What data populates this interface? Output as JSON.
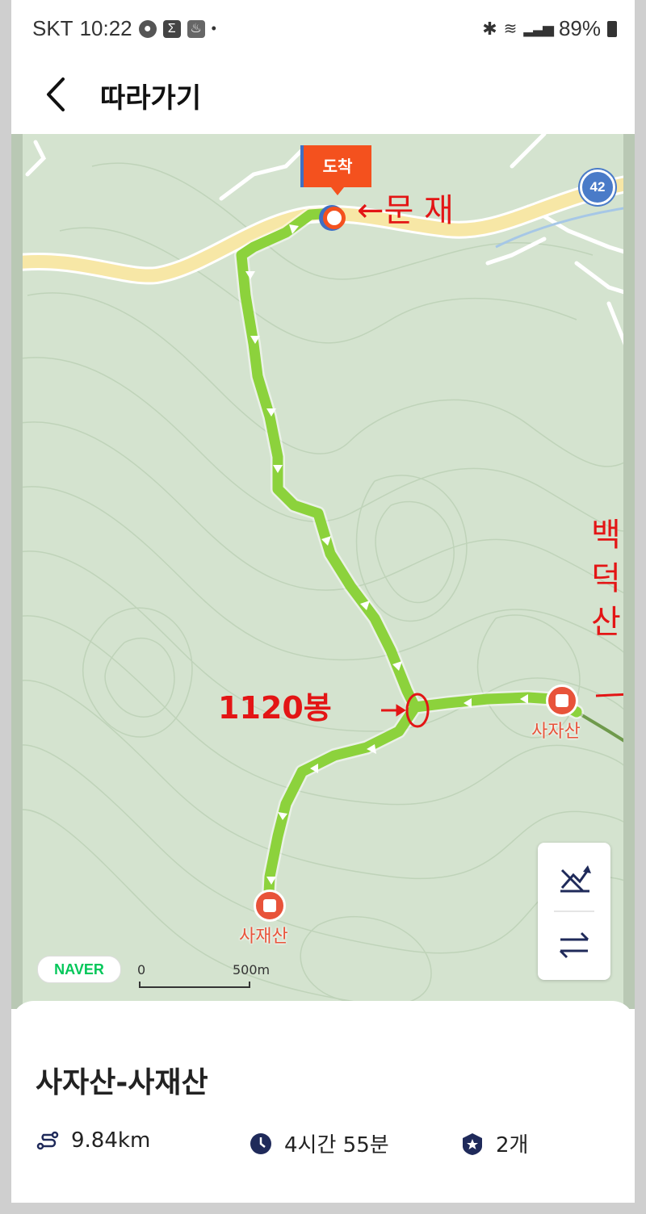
{
  "status_bar": {
    "carrier": "SKT",
    "time": "10:22",
    "battery": "89%"
  },
  "header": {
    "title": "따라가기"
  },
  "map": {
    "road_number": "42",
    "destination_flag": "도착",
    "annotations": {
      "munjae": "←문 재",
      "peak_1120": "1120봉",
      "baekdeoksan": "백덕산"
    },
    "peaks": [
      "사자산",
      "사재산"
    ],
    "provider_logo": "NAVER",
    "scale": {
      "start": "0",
      "end": "500m"
    },
    "colors": {
      "route": "#8cd23c",
      "road": "#f7e7a6",
      "terrain": "#d4e3cf",
      "annotation": "#e31515",
      "peak": "#e8533a"
    }
  },
  "route": {
    "title": "사자산-사재산",
    "distance": "9.84km",
    "duration": "4시간 55분",
    "checkpoints": "2개"
  }
}
